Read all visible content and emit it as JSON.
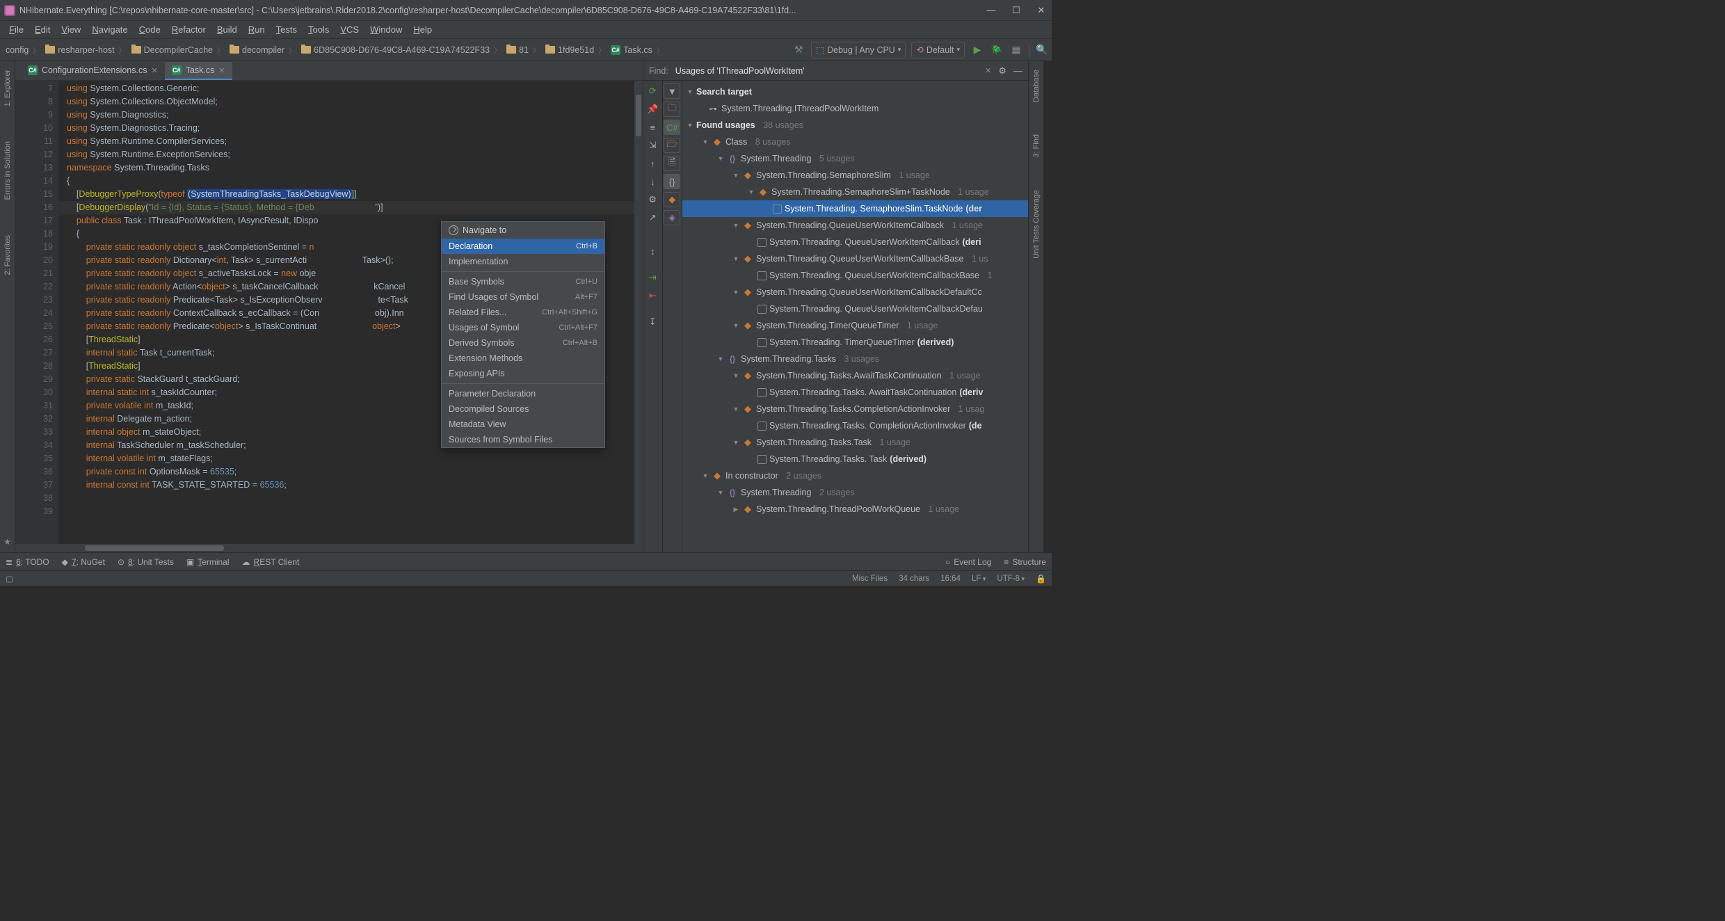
{
  "title": "NHibernate.Everything [C:\\repos\\nhibernate-core-master\\src] - C:\\Users\\jetbrains\\.Rider2018.2\\config\\resharper-host\\DecompilerCache\\decompiler\\6D85C908-D676-49C8-A469-C19A74522F33\\81\\1fd...",
  "menu": [
    "File",
    "Edit",
    "View",
    "Navigate",
    "Code",
    "Refactor",
    "Build",
    "Run",
    "Tests",
    "Tools",
    "VCS",
    "Window",
    "Help"
  ],
  "breadcrumbs": [
    {
      "label": "config",
      "icon": "none"
    },
    {
      "label": "resharper-host",
      "icon": "folder"
    },
    {
      "label": "DecompilerCache",
      "icon": "folder"
    },
    {
      "label": "decompiler",
      "icon": "folder"
    },
    {
      "label": "6D85C908-D676-49C8-A469-C19A74522F33",
      "icon": "folder"
    },
    {
      "label": "81",
      "icon": "folder"
    },
    {
      "label": "1fd9e51d",
      "icon": "folder"
    },
    {
      "label": "Task.cs",
      "icon": "cs"
    }
  ],
  "run_config": {
    "debug": "Debug | Any CPU",
    "default": "Default"
  },
  "tabs": [
    {
      "label": "ConfigurationExtensions.cs",
      "active": false
    },
    {
      "label": "Task.cs",
      "active": true
    }
  ],
  "gutter_start": 7,
  "gutter_end": 39,
  "code_lines": [
    [
      [
        "kw",
        "using "
      ],
      [
        "",
        "System.Collections.Generic;"
      ]
    ],
    [
      [
        "kw",
        "using "
      ],
      [
        "",
        "System.Collections.ObjectModel;"
      ]
    ],
    [
      [
        "kw",
        "using "
      ],
      [
        "",
        "System.Diagnostics;"
      ]
    ],
    [
      [
        "kw",
        "using "
      ],
      [
        "",
        "System.Diagnostics.Tracing;"
      ]
    ],
    [
      [
        "kw",
        "using "
      ],
      [
        "",
        "System.Runtime.CompilerServices;"
      ]
    ],
    [
      [
        "kw",
        "using "
      ],
      [
        "",
        "System.Runtime.ExceptionServices;"
      ]
    ],
    [
      [
        "",
        ""
      ]
    ],
    [
      [
        "kw",
        "namespace "
      ],
      [
        "",
        "System.Threading.Tasks"
      ]
    ],
    [
      [
        "",
        "{"
      ]
    ],
    [
      [
        "",
        "    ["
      ],
      [
        "attr",
        "DebuggerTypeProxy"
      ],
      [
        "",
        "("
      ],
      [
        "kw",
        "typeof "
      ],
      [
        "sel",
        "(SystemThreadingTasks_TaskDebugView)"
      ],
      [
        "",
        "]]"
      ]
    ],
    [
      [
        "",
        "    ["
      ],
      [
        "attr",
        "DebuggerDisplay"
      ],
      [
        "",
        "("
      ],
      [
        "str",
        "\"Id = {Id}, Status = {Status}, Method = {Deb"
      ],
      [
        "",
        "                         "
      ],
      [
        "str",
        "\""
      ],
      [
        "",
        ")]"
      ]
    ],
    [
      [
        "",
        "    "
      ],
      [
        "kw",
        "public class "
      ],
      [
        "typ",
        "Task"
      ],
      [
        "",
        " : IThreadPoolWorkItem, IAsyncResult, IDispo"
      ]
    ],
    [
      [
        "",
        "    {"
      ]
    ],
    [
      [
        "",
        "        "
      ],
      [
        "kw",
        "private static readonly object"
      ],
      [
        "",
        " s_taskCompletionSentinel = "
      ],
      [
        "kw",
        "n"
      ]
    ],
    [
      [
        "",
        "        "
      ],
      [
        "kw",
        "private static readonly "
      ],
      [
        "typ",
        "Dictionary"
      ],
      [
        "",
        "<"
      ],
      [
        "kw",
        "int"
      ],
      [
        "",
        ", "
      ],
      [
        "typ",
        "Task"
      ],
      [
        "",
        "> s_currentActi"
      ],
      [
        "",
        "                       "
      ],
      [
        "typ",
        "Task"
      ],
      [
        "",
        ">();"
      ]
    ],
    [
      [
        "",
        "        "
      ],
      [
        "kw",
        "private static readonly object"
      ],
      [
        "",
        " s_activeTasksLock = "
      ],
      [
        "kw",
        "new "
      ],
      [
        "",
        "obje"
      ]
    ],
    [
      [
        "",
        "        "
      ],
      [
        "kw",
        "private static readonly "
      ],
      [
        "typ",
        "Action"
      ],
      [
        "",
        "<"
      ],
      [
        "kw",
        "object"
      ],
      [
        "",
        "> s_taskCancelCallback"
      ],
      [
        "",
        "                       kCancel"
      ]
    ],
    [
      [
        "",
        "        "
      ],
      [
        "kw",
        "private static readonly "
      ],
      [
        "typ",
        "Predicate"
      ],
      [
        "",
        "<"
      ],
      [
        "typ",
        "Task"
      ],
      [
        "",
        "> s_IsExceptionObserv"
      ],
      [
        "",
        "                       te<"
      ],
      [
        "typ",
        "Task"
      ],
      [
        "",
        " "
      ]
    ],
    [
      [
        "",
        "        "
      ],
      [
        "kw",
        "private static readonly "
      ],
      [
        "typ",
        "ContextCallback"
      ],
      [
        "",
        " s_ecCallback = (Con"
      ],
      [
        "",
        "                       obj).Inn"
      ]
    ],
    [
      [
        "",
        "        "
      ],
      [
        "kw",
        "private static readonly "
      ],
      [
        "typ",
        "Predicate"
      ],
      [
        "",
        "<"
      ],
      [
        "kw",
        "object"
      ],
      [
        "",
        "> s_IsTaskContinuat"
      ],
      [
        "",
        "                       "
      ],
      [
        "kw",
        "object"
      ],
      [
        "",
        ">"
      ]
    ],
    [
      [
        "",
        "        ["
      ],
      [
        "attr",
        "ThreadStatic"
      ],
      [
        "",
        "]"
      ]
    ],
    [
      [
        "",
        "        "
      ],
      [
        "kw",
        "internal static "
      ],
      [
        "typ",
        "Task"
      ],
      [
        "",
        " t_currentTask;"
      ]
    ],
    [
      [
        "",
        "        ["
      ],
      [
        "attr",
        "ThreadStatic"
      ],
      [
        "",
        "]"
      ]
    ],
    [
      [
        "",
        "        "
      ],
      [
        "kw",
        "private static "
      ],
      [
        "typ",
        "StackGuard"
      ],
      [
        "",
        " t_stackGuard;"
      ]
    ],
    [
      [
        "",
        "        "
      ],
      [
        "kw",
        "internal static int"
      ],
      [
        "",
        " s_taskIdCounter;"
      ]
    ],
    [
      [
        "",
        "        "
      ],
      [
        "kw",
        "private volatile int"
      ],
      [
        "",
        " m_taskId;"
      ]
    ],
    [
      [
        "",
        "        "
      ],
      [
        "kw",
        "internal "
      ],
      [
        "typ",
        "Delegate"
      ],
      [
        "",
        " m_action;"
      ]
    ],
    [
      [
        "",
        "        "
      ],
      [
        "kw",
        "internal object"
      ],
      [
        "",
        " m_stateObject;"
      ]
    ],
    [
      [
        "",
        "        "
      ],
      [
        "kw",
        "internal "
      ],
      [
        "typ",
        "TaskScheduler"
      ],
      [
        "",
        " m_taskScheduler;"
      ]
    ],
    [
      [
        "",
        "        "
      ],
      [
        "kw",
        "internal volatile int"
      ],
      [
        "",
        " m_stateFlags;"
      ]
    ],
    [
      [
        "",
        "        "
      ],
      [
        "kw",
        "private const int"
      ],
      [
        "",
        " OptionsMask = "
      ],
      [
        "num",
        "65535"
      ],
      [
        "",
        ";"
      ]
    ],
    [
      [
        "",
        "        "
      ],
      [
        "kw",
        "internal const int"
      ],
      [
        "",
        " TASK_STATE_STARTED = "
      ],
      [
        "num",
        "65536"
      ],
      [
        "",
        ";"
      ]
    ]
  ],
  "context_menu": {
    "head": "Navigate to",
    "items": [
      {
        "label": "Declaration",
        "sc": "Ctrl+B",
        "sel": true
      },
      {
        "label": "Implementation"
      },
      {
        "sep": true
      },
      {
        "label": "Base Symbols",
        "sc": "Ctrl+U"
      },
      {
        "label": "Find Usages of Symbol",
        "sc": "Alt+F7"
      },
      {
        "label": "Related Files...",
        "sc": "Ctrl+Alt+Shift+G"
      },
      {
        "label": "Usages of Symbol",
        "sc": "Ctrl+Alt+F7"
      },
      {
        "label": "Derived Symbols",
        "sc": "Ctrl+Alt+B"
      },
      {
        "label": "Extension Methods"
      },
      {
        "label": "Exposing APIs"
      },
      {
        "sep": true
      },
      {
        "label": "Parameter Declaration"
      },
      {
        "label": "Decompiled Sources"
      },
      {
        "label": "Metadata View"
      },
      {
        "label": "Sources from Symbol Files"
      }
    ]
  },
  "find": {
    "label": "Find:",
    "query": "Usages of 'IThreadPoolWorkItem'",
    "search_target_label": "Search target",
    "search_target": "System.Threading.IThreadPoolWorkItem",
    "found_label": "Found usages",
    "found_hint": "38 usages",
    "tree": [
      {
        "d": 1,
        "tw": "▼",
        "ic": "cls",
        "label": "Class",
        "hint": "8 usages"
      },
      {
        "d": 2,
        "tw": "▼",
        "ic": "iface",
        "label": "System.Threading",
        "hint": "5 usages"
      },
      {
        "d": 3,
        "tw": "▼",
        "ic": "cls",
        "label": "System.Threading.SemaphoreSlim",
        "hint": "1 usage"
      },
      {
        "d": 4,
        "tw": "▼",
        "ic": "cls",
        "label": "System.Threading.SemaphoreSlim+TaskNode",
        "hint": "1 usage"
      },
      {
        "d": 5,
        "tw": "",
        "ic": "chk",
        "label": "System.Threading. SemaphoreSlim.TaskNode ",
        "bold": "(der",
        "sel": true
      },
      {
        "d": 3,
        "tw": "▼",
        "ic": "cls",
        "label": "System.Threading.QueueUserWorkItemCallback",
        "hint": "1 usage"
      },
      {
        "d": 4,
        "tw": "",
        "ic": "chk",
        "label": "System.Threading. QueueUserWorkItemCallback ",
        "bold": "(deri"
      },
      {
        "d": 3,
        "tw": "▼",
        "ic": "cls",
        "label": "System.Threading.QueueUserWorkItemCallbackBase",
        "hint": "1 us"
      },
      {
        "d": 4,
        "tw": "",
        "ic": "chk",
        "label": "System.Threading. QueueUserWorkItemCallbackBase ",
        "hint": "1"
      },
      {
        "d": 3,
        "tw": "▼",
        "ic": "cls",
        "label": "System.Threading.QueueUserWorkItemCallbackDefaultCc",
        "hint": ""
      },
      {
        "d": 4,
        "tw": "",
        "ic": "chk",
        "label": "System.Threading. QueueUserWorkItemCallbackDefau",
        "hint": ""
      },
      {
        "d": 3,
        "tw": "▼",
        "ic": "cls",
        "label": "System.Threading.TimerQueueTimer",
        "hint": "1 usage"
      },
      {
        "d": 4,
        "tw": "",
        "ic": "chk",
        "label": "System.Threading. TimerQueueTimer ",
        "bold": "(derived)"
      },
      {
        "d": 2,
        "tw": "▼",
        "ic": "iface",
        "label": "System.Threading.Tasks",
        "hint": "3 usages"
      },
      {
        "d": 3,
        "tw": "▼",
        "ic": "cls",
        "label": "System.Threading.Tasks.AwaitTaskContinuation",
        "hint": "1 usage"
      },
      {
        "d": 4,
        "tw": "",
        "ic": "chk",
        "label": "System.Threading.Tasks. AwaitTaskContinuation ",
        "bold": "(deriv"
      },
      {
        "d": 3,
        "tw": "▼",
        "ic": "cls",
        "label": "System.Threading.Tasks.CompletionActionInvoker",
        "hint": "1 usag"
      },
      {
        "d": 4,
        "tw": "",
        "ic": "chk",
        "label": "System.Threading.Tasks. CompletionActionInvoker ",
        "bold": "(de"
      },
      {
        "d": 3,
        "tw": "▼",
        "ic": "cls",
        "label": "System.Threading.Tasks.Task",
        "hint": "1 usage"
      },
      {
        "d": 4,
        "tw": "",
        "ic": "chk",
        "label": "System.Threading.Tasks. Task ",
        "bold": "(derived)"
      },
      {
        "d": 1,
        "tw": "▼",
        "ic": "cls",
        "label": "In constructor",
        "hint": "2 usages"
      },
      {
        "d": 2,
        "tw": "▼",
        "ic": "iface",
        "label": "System.Threading",
        "hint": "2 usages"
      },
      {
        "d": 3,
        "tw": "▶",
        "ic": "cls",
        "label": "System.Threading.ThreadPoolWorkQueue",
        "hint": "1 usage"
      }
    ]
  },
  "left_rail": [
    {
      "label": "1: Explorer"
    },
    {
      "label": "Errors in Solution"
    },
    {
      "label": "2: Favorites"
    }
  ],
  "right_rail": [
    {
      "label": "Database"
    },
    {
      "label": "3: Find"
    },
    {
      "label": "Unit Tests Coverage"
    }
  ],
  "tool_items": [
    {
      "ic": "≣",
      "label": "6: TODO"
    },
    {
      "ic": "◆",
      "label": "7: NuGet"
    },
    {
      "ic": "⊙",
      "label": "8: Unit Tests"
    },
    {
      "ic": "▣",
      "label": "Terminal"
    },
    {
      "ic": "☁",
      "label": "REST Client"
    }
  ],
  "tool_right": [
    {
      "ic": "○",
      "label": "Event Log"
    },
    {
      "ic": "≡",
      "label": "Structure"
    }
  ],
  "status": {
    "misc": "Misc Files",
    "chars": "34 chars",
    "pos": "16:64",
    "le": "LF",
    "enc": "UTF-8"
  }
}
